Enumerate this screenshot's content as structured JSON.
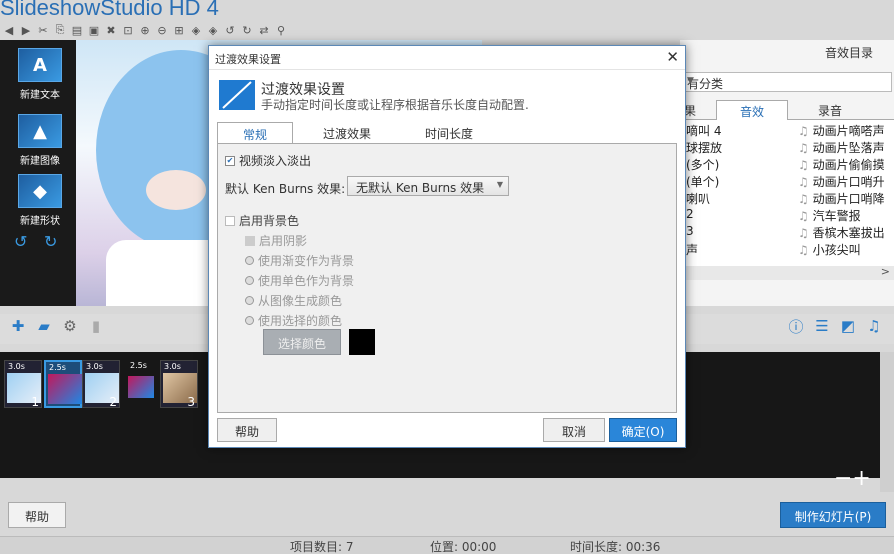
{
  "app": {
    "title": "SlideshowStudio HD 4"
  },
  "toolbar": {
    "icons": [
      "prev-icon",
      "next-icon",
      "cut-icon",
      "copy-icon",
      "paste-icon",
      "trim-icon",
      "delete-icon",
      "zoom-fit-icon",
      "zoom-in-icon",
      "zoom-out-icon",
      "zoom-reset-icon",
      "tag-icon",
      "tag2-icon",
      "rotate-left-icon",
      "rotate-right-icon",
      "share-icon",
      "pin-icon"
    ]
  },
  "left_panel": {
    "new_text": "新建文本",
    "new_image": "新建图像",
    "new_shape": "新建形状"
  },
  "right_panel": {
    "title": "音效目录",
    "category_value": "有分类",
    "tabs": [
      "果",
      "音效",
      "录音"
    ],
    "left_items": [
      "嘀叫 4",
      "球摆放",
      "(多个)",
      "(单个)",
      "喇叭",
      "2",
      "3",
      "声"
    ],
    "right_items": [
      "动画片嘀嗒声",
      "动画片坠落声",
      "动画片偷偷摸",
      "动画片口哨升",
      "动画片口哨降",
      "汽车警报",
      "香槟木塞拔出",
      "小孩尖叫"
    ]
  },
  "timeline": {
    "clips": [
      {
        "duration": "3.0s",
        "number": "1"
      },
      {
        "duration": "2.5s",
        "number": ""
      },
      {
        "duration": "3.0s",
        "number": "2"
      },
      {
        "duration": "2.5s",
        "number": ""
      },
      {
        "duration": "3.0s",
        "number": "3"
      }
    ],
    "zoom_label": "−+"
  },
  "bottom": {
    "help": "帮助",
    "make": "制作幻灯片(P)"
  },
  "status": {
    "items": "项目数目: 7",
    "position": "位置: 00:00",
    "duration": "时间长度: 00:36"
  },
  "dialog": {
    "title": "过渡效果设置",
    "heading": "过渡效果设置",
    "subheading": "手动指定时间长度或让程序根据音乐长度自动配置.",
    "tabs": [
      "常规",
      "过渡效果",
      "时间长度"
    ],
    "video_fade": "视频淡入淡出",
    "ken_burns_label": "默认 Ken Burns 效果:",
    "ken_burns_value": "无默认 Ken Burns 效果",
    "enable_bg": "启用背景色",
    "enable_shadow": "启用阴影",
    "opt_gradient": "使用渐变作为背景",
    "opt_solid": "使用单色作为背景",
    "opt_from_image": "从图像生成颜色",
    "opt_selected": "使用选择的颜色",
    "choose_color": "选择颜色",
    "help": "帮助",
    "cancel": "取消",
    "ok": "确定(O)",
    "close": "✕"
  },
  "colors": {
    "accent": "#2a7cc7",
    "timeline_bg": "#171717",
    "swatch": "#000000"
  }
}
